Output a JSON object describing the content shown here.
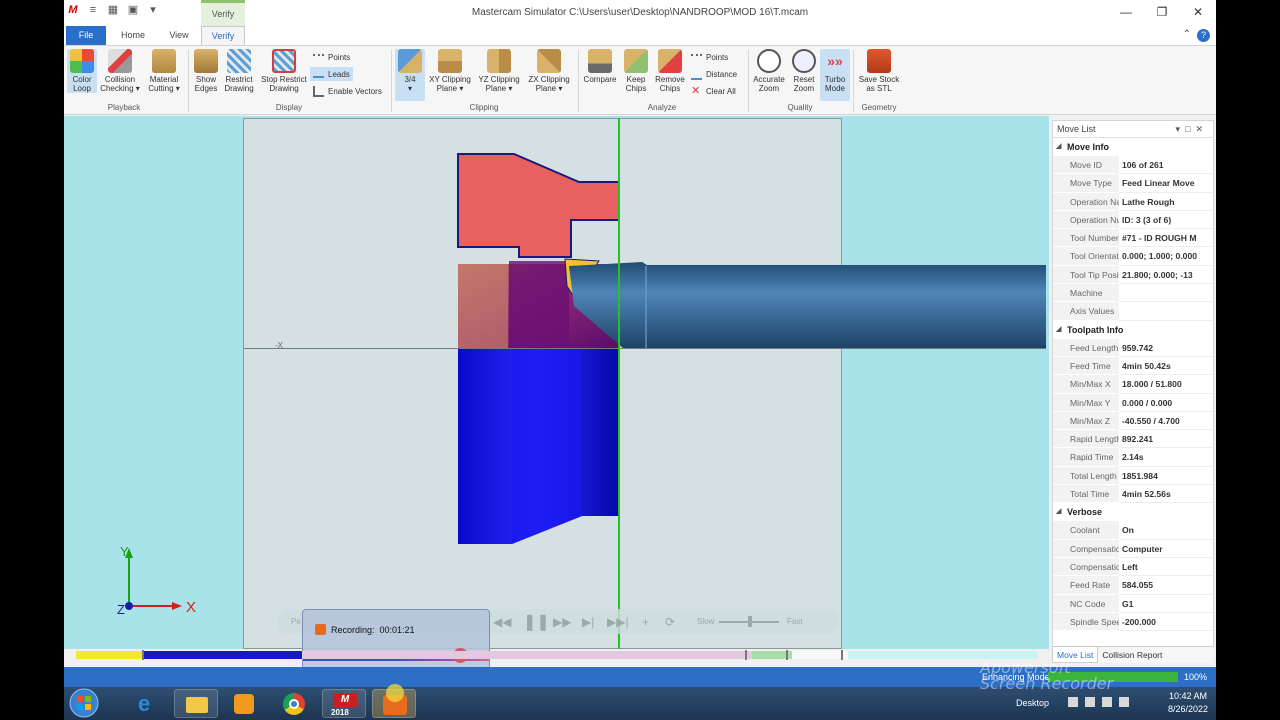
{
  "titlebar": {
    "title": "Mastercam Simulator  C:\\Users\\user\\Desktop\\NANDROOP\\MOD 16\\T.mcam",
    "context_tab": "Verify",
    "min": "—",
    "max": "❐",
    "close": "✕"
  },
  "tabs": {
    "file": "File",
    "home": "Home",
    "view": "View",
    "verify": "Verify"
  },
  "ribbon": {
    "color_loop": [
      "Color",
      "Loop"
    ],
    "collision_checking": [
      "Collision",
      "Checking ▾"
    ],
    "material_cutting": [
      "Material",
      "Cutting ▾"
    ],
    "playback_label": "Playback",
    "show_edges": [
      "Show",
      "Edges"
    ],
    "restrict_drawing": [
      "Restrict",
      "Drawing"
    ],
    "stop_restrict_drawing": [
      "Stop Restrict",
      "Drawing"
    ],
    "points": "Points",
    "leads": "Leads",
    "enable_vectors": "Enable Vectors",
    "display_label": "Display",
    "three_quarter": [
      "3/4",
      "▾"
    ],
    "xy_clipping": [
      "XY Clipping",
      "Plane ▾"
    ],
    "yz_clipping": [
      "YZ Clipping",
      "Plane ▾"
    ],
    "zx_clipping": [
      "ZX Clipping",
      "Plane ▾"
    ],
    "clipping_label": "Clipping",
    "compare": "Compare",
    "keep_chips": [
      "Keep",
      "Chips"
    ],
    "remove_chips": [
      "Remove",
      "Chips"
    ],
    "an_points": "Points",
    "distance": "Distance",
    "clear_all": "Clear All",
    "analyze_label": "Analyze",
    "accurate_zoom": [
      "Accurate",
      "Zoom"
    ],
    "reset_zoom": [
      "Reset",
      "Zoom"
    ],
    "turbo_mode": [
      "Turbo",
      "Mode"
    ],
    "quality_label": "Quality",
    "save_stock": [
      "Save Stock",
      "as STL"
    ],
    "geometry_label": "Geometry"
  },
  "viewport": {
    "axis_marker": "-X",
    "triad": {
      "y": "Y",
      "z": "Z",
      "x": "X"
    },
    "controls": {
      "slow": "Slow",
      "fast": "Fast",
      "pe": "Pe"
    },
    "recording": {
      "label": "Recording:",
      "time": "00:01:21"
    }
  },
  "move_list": {
    "title": "Move List",
    "sections": [
      {
        "name": "Move Info",
        "rows": [
          {
            "k": "Move ID",
            "v": "106 of 261"
          },
          {
            "k": "Move Type",
            "v": "Feed Linear Move"
          },
          {
            "k": "Operation Na",
            "v": "Lathe Rough"
          },
          {
            "k": "Operation Nu",
            "v": "ID: 3 (3 of 6)"
          },
          {
            "k": "Tool Number",
            "v": "#71 - ID ROUGH M"
          },
          {
            "k": "Tool Orientati",
            "v": "0.000; 1.000; 0.000"
          },
          {
            "k": "Tool Tip Posit",
            "v": "21.800; 0.000; -13"
          },
          {
            "k": "Machine",
            "v": ""
          },
          {
            "k": "Axis Values",
            "v": ""
          }
        ]
      },
      {
        "name": "Toolpath Info",
        "rows": [
          {
            "k": "Feed Length",
            "v": "959.742"
          },
          {
            "k": "Feed Time",
            "v": "4min 50.42s"
          },
          {
            "k": "Min/Max X",
            "v": "18.000 / 51.800"
          },
          {
            "k": "Min/Max Y",
            "v": "0.000 / 0.000"
          },
          {
            "k": "Min/Max Z",
            "v": "-40.550 / 4.700"
          },
          {
            "k": "Rapid Length",
            "v": "892.241"
          },
          {
            "k": "Rapid Time",
            "v": "2.14s"
          },
          {
            "k": "Total Length",
            "v": "1851.984"
          },
          {
            "k": "Total Time",
            "v": "4min 52.56s"
          }
        ]
      },
      {
        "name": "Verbose",
        "rows": [
          {
            "k": "Coolant",
            "v": "On"
          },
          {
            "k": "Compensation",
            "v": "Computer"
          },
          {
            "k": "Compensation",
            "v": "Left"
          },
          {
            "k": "Feed Rate",
            "v": "584.055"
          },
          {
            "k": "NC Code",
            "v": "G1"
          },
          {
            "k": "Spindle Speed",
            "v": "-200.000"
          }
        ]
      }
    ],
    "tabs": {
      "move_list": "Move List",
      "collision_report": "Collision Report"
    }
  },
  "status": {
    "text": "Enhancing Model",
    "progress": 1.0,
    "percent": "100%"
  },
  "taskbar": {
    "mastercam_year": "2018",
    "desktop": "Desktop",
    "time": "10:42 AM",
    "date": "8/26/2022",
    "watermark": [
      "Apowersoft",
      "Screen Recorder"
    ]
  },
  "colors": {
    "accent": "#2a6fc9",
    "stock_red": "#e96060",
    "part_blue": "#1010d8",
    "tool_blue": "#2e5d86",
    "viewport_bg": "#a9e3ea",
    "status_blue": "#2c6fc5"
  }
}
